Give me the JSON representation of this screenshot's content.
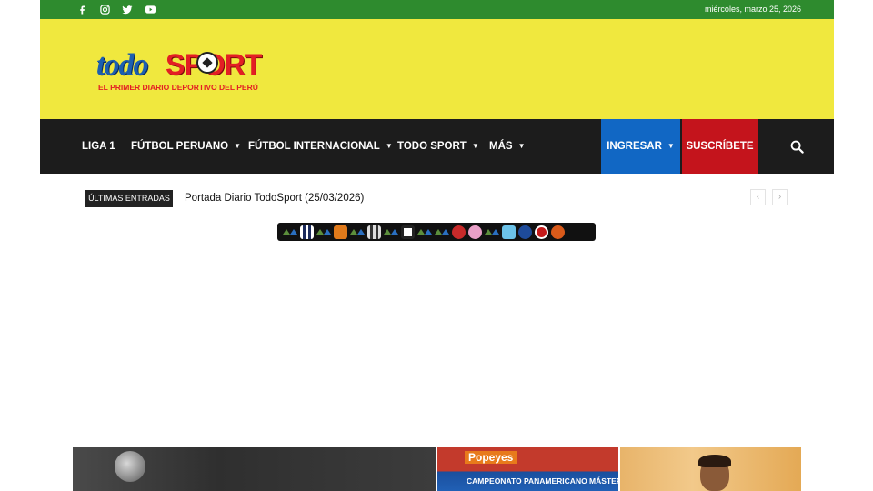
{
  "topbar": {
    "date": "miércoles, marzo 25, 2026",
    "social": [
      "facebook-icon",
      "instagram-icon",
      "twitter-icon",
      "youtube-icon"
    ],
    "bg": "#2e8b2e"
  },
  "header": {
    "bg": "#f0e83e",
    "logo_todo": "todo",
    "logo_sport": "SPORT",
    "tagline": "EL PRIMER DIARIO DEPORTIVO DEL PERÚ"
  },
  "nav": {
    "items": [
      {
        "label": "LIGA 1",
        "has_menu": false
      },
      {
        "label": "FÚTBOL PERUANO",
        "has_menu": true
      },
      {
        "label": "FÚTBOL INTERNACIONAL",
        "has_menu": true
      },
      {
        "label": "TODO SPORT",
        "has_menu": true
      },
      {
        "label": "MÁS",
        "has_menu": true
      }
    ],
    "login": "INGRESAR",
    "subscribe": "SUSCRÍBETE",
    "search_icon": "search-icon",
    "colors": {
      "login": "#1167c4",
      "subscribe": "#c4141c",
      "bar": "#1c1c1c"
    }
  },
  "ticker": {
    "label": "ÚLTIMAS ENTRADAS",
    "headline": "Portada Diario TodoSport (25/03/2026)",
    "prev_icon": "chevron-left-icon",
    "next_icon": "chevron-right-icon"
  },
  "featured": {
    "card2_brand": "Popeyes",
    "card2_title": "CAMPEONATO PANAMERICANO MÁSTER"
  }
}
